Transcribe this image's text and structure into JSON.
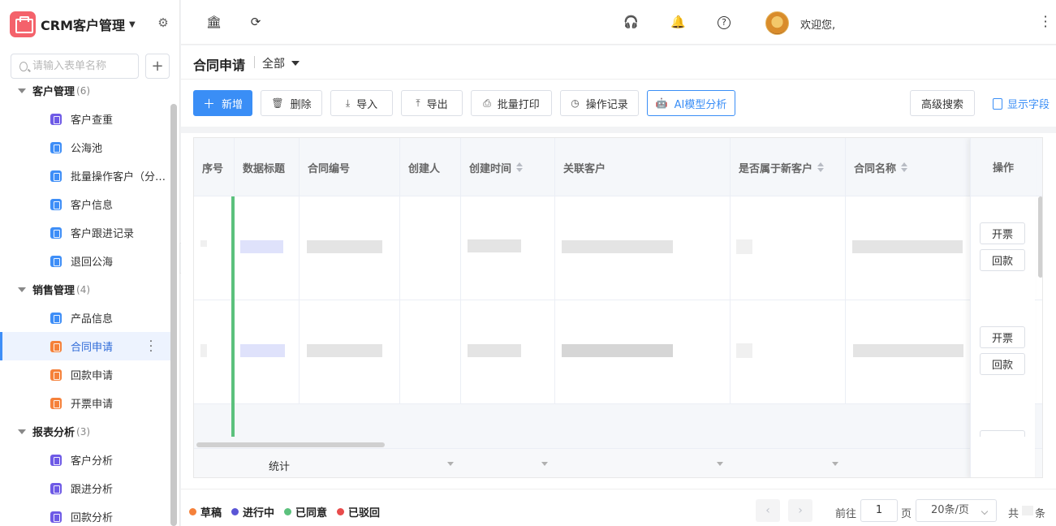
{
  "app": {
    "title": "CRM客户管理"
  },
  "sidebar": {
    "search_placeholder": "请输入表单名称",
    "groups": [
      {
        "label": "客户管理",
        "count": "(6)",
        "items": [
          "客户查重",
          "公海池",
          "批量操作客户（分…",
          "客户信息",
          "客户跟进记录",
          "退回公海"
        ]
      },
      {
        "label": "销售管理",
        "count": "(4)",
        "items": [
          "产品信息",
          "合同申请",
          "回款申请",
          "开票申请"
        ]
      },
      {
        "label": "报表分析",
        "count": "(3)",
        "items": [
          "客户分析",
          "跟进分析",
          "回款分析"
        ]
      }
    ],
    "active_item": "合同申请"
  },
  "header": {
    "welcome": "欢迎您,"
  },
  "page": {
    "title": "合同申请",
    "scope": "全部"
  },
  "toolbar": {
    "new": "新增",
    "delete": "删除",
    "import": "导入",
    "export": "导出",
    "batch_print": "批量打印",
    "op_log": "操作记录",
    "ai": "AI模型分析",
    "advanced_search": "高级搜索",
    "show_fields": "显示字段"
  },
  "table": {
    "columns": [
      "序号",
      "数据标题",
      "合同编号",
      "创建人",
      "创建时间",
      "关联客户",
      "是否属于新客户",
      "合同名称"
    ],
    "op_column": "操作",
    "row_actions": [
      "开票",
      "回款"
    ],
    "summary_label": "统计"
  },
  "legend": [
    {
      "label": "草稿",
      "color": "#f5813a"
    },
    {
      "label": "进行中",
      "color": "#5a55d6"
    },
    {
      "label": "已同意",
      "color": "#5cc17d"
    },
    {
      "label": "已驳回",
      "color": "#e84b4b"
    }
  ],
  "pagination": {
    "goto_prefix": "前往",
    "page": "1",
    "page_suffix": "页",
    "page_size": "20条/页",
    "total_prefix": "共",
    "total_suffix": "条"
  }
}
